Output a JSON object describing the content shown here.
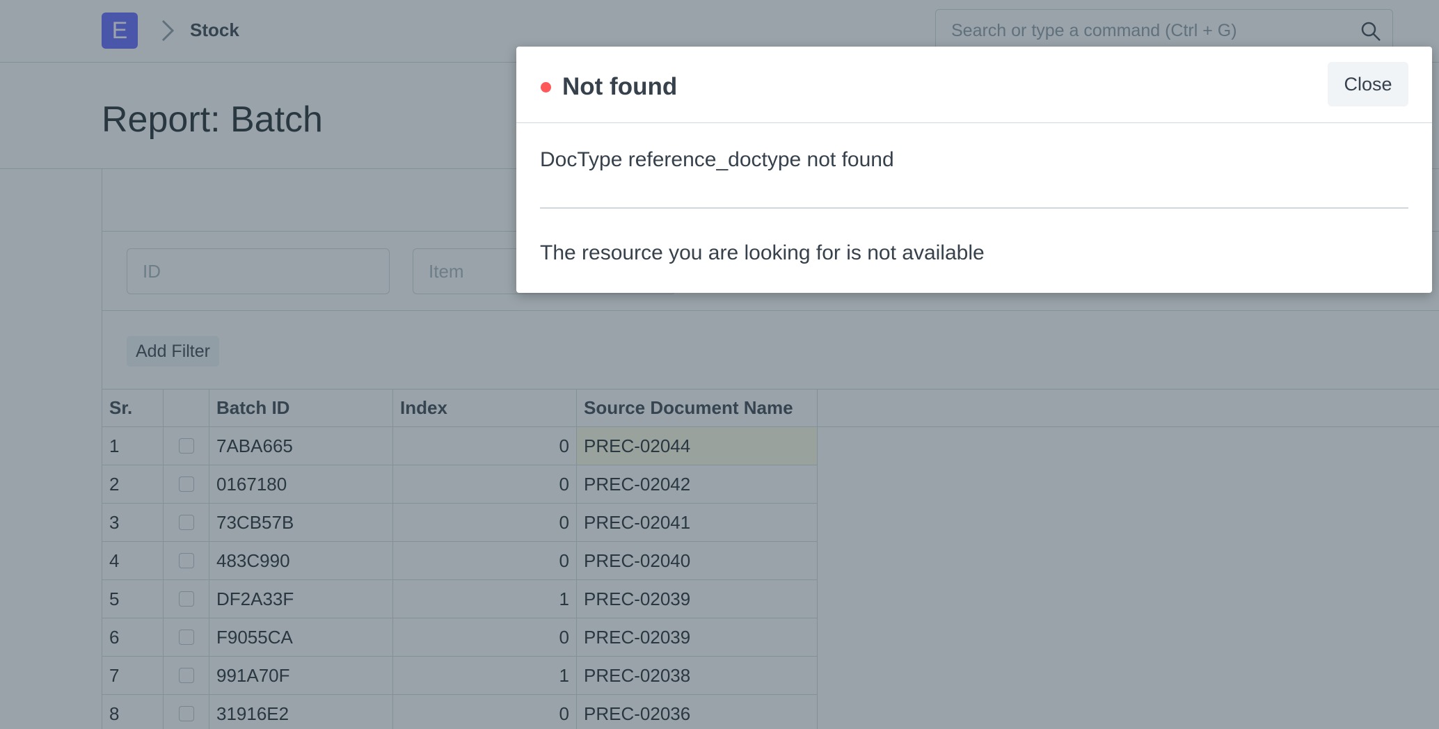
{
  "navbar": {
    "logo_letter": "E",
    "breadcrumb": "Stock",
    "search_placeholder": "Search or type a command (Ctrl + G)"
  },
  "page": {
    "title": "Report: Batch"
  },
  "filters": {
    "id_placeholder": "ID",
    "item_placeholder": "Item",
    "add_filter_label": "Add Filter"
  },
  "table": {
    "columns": [
      "Sr.",
      "",
      "Batch ID",
      "Index",
      "Source Document Name"
    ],
    "rows": [
      {
        "sr": "1",
        "batch_id": "7ABA665",
        "index": "0",
        "source": "PREC-02044"
      },
      {
        "sr": "2",
        "batch_id": "0167180",
        "index": "0",
        "source": "PREC-02042"
      },
      {
        "sr": "3",
        "batch_id": "73CB57B",
        "index": "0",
        "source": "PREC-02041"
      },
      {
        "sr": "4",
        "batch_id": "483C990",
        "index": "0",
        "source": "PREC-02040"
      },
      {
        "sr": "5",
        "batch_id": "DF2A33F",
        "index": "1",
        "source": "PREC-02039"
      },
      {
        "sr": "6",
        "batch_id": "F9055CA",
        "index": "0",
        "source": "PREC-02039"
      },
      {
        "sr": "7",
        "batch_id": "991A70F",
        "index": "1",
        "source": "PREC-02038"
      },
      {
        "sr": "8",
        "batch_id": "31916E2",
        "index": "0",
        "source": "PREC-02036"
      }
    ]
  },
  "modal": {
    "title": "Not found",
    "indicator_color": "#ff5858",
    "close_label": "Close",
    "message": "DocType reference_doctype not found",
    "detail": "The resource you are looking for is not available"
  },
  "colors": {
    "brand": "#5e64ff",
    "backdrop": "rgba(52, 72, 84, 0.5)",
    "error": "#ff5858"
  }
}
